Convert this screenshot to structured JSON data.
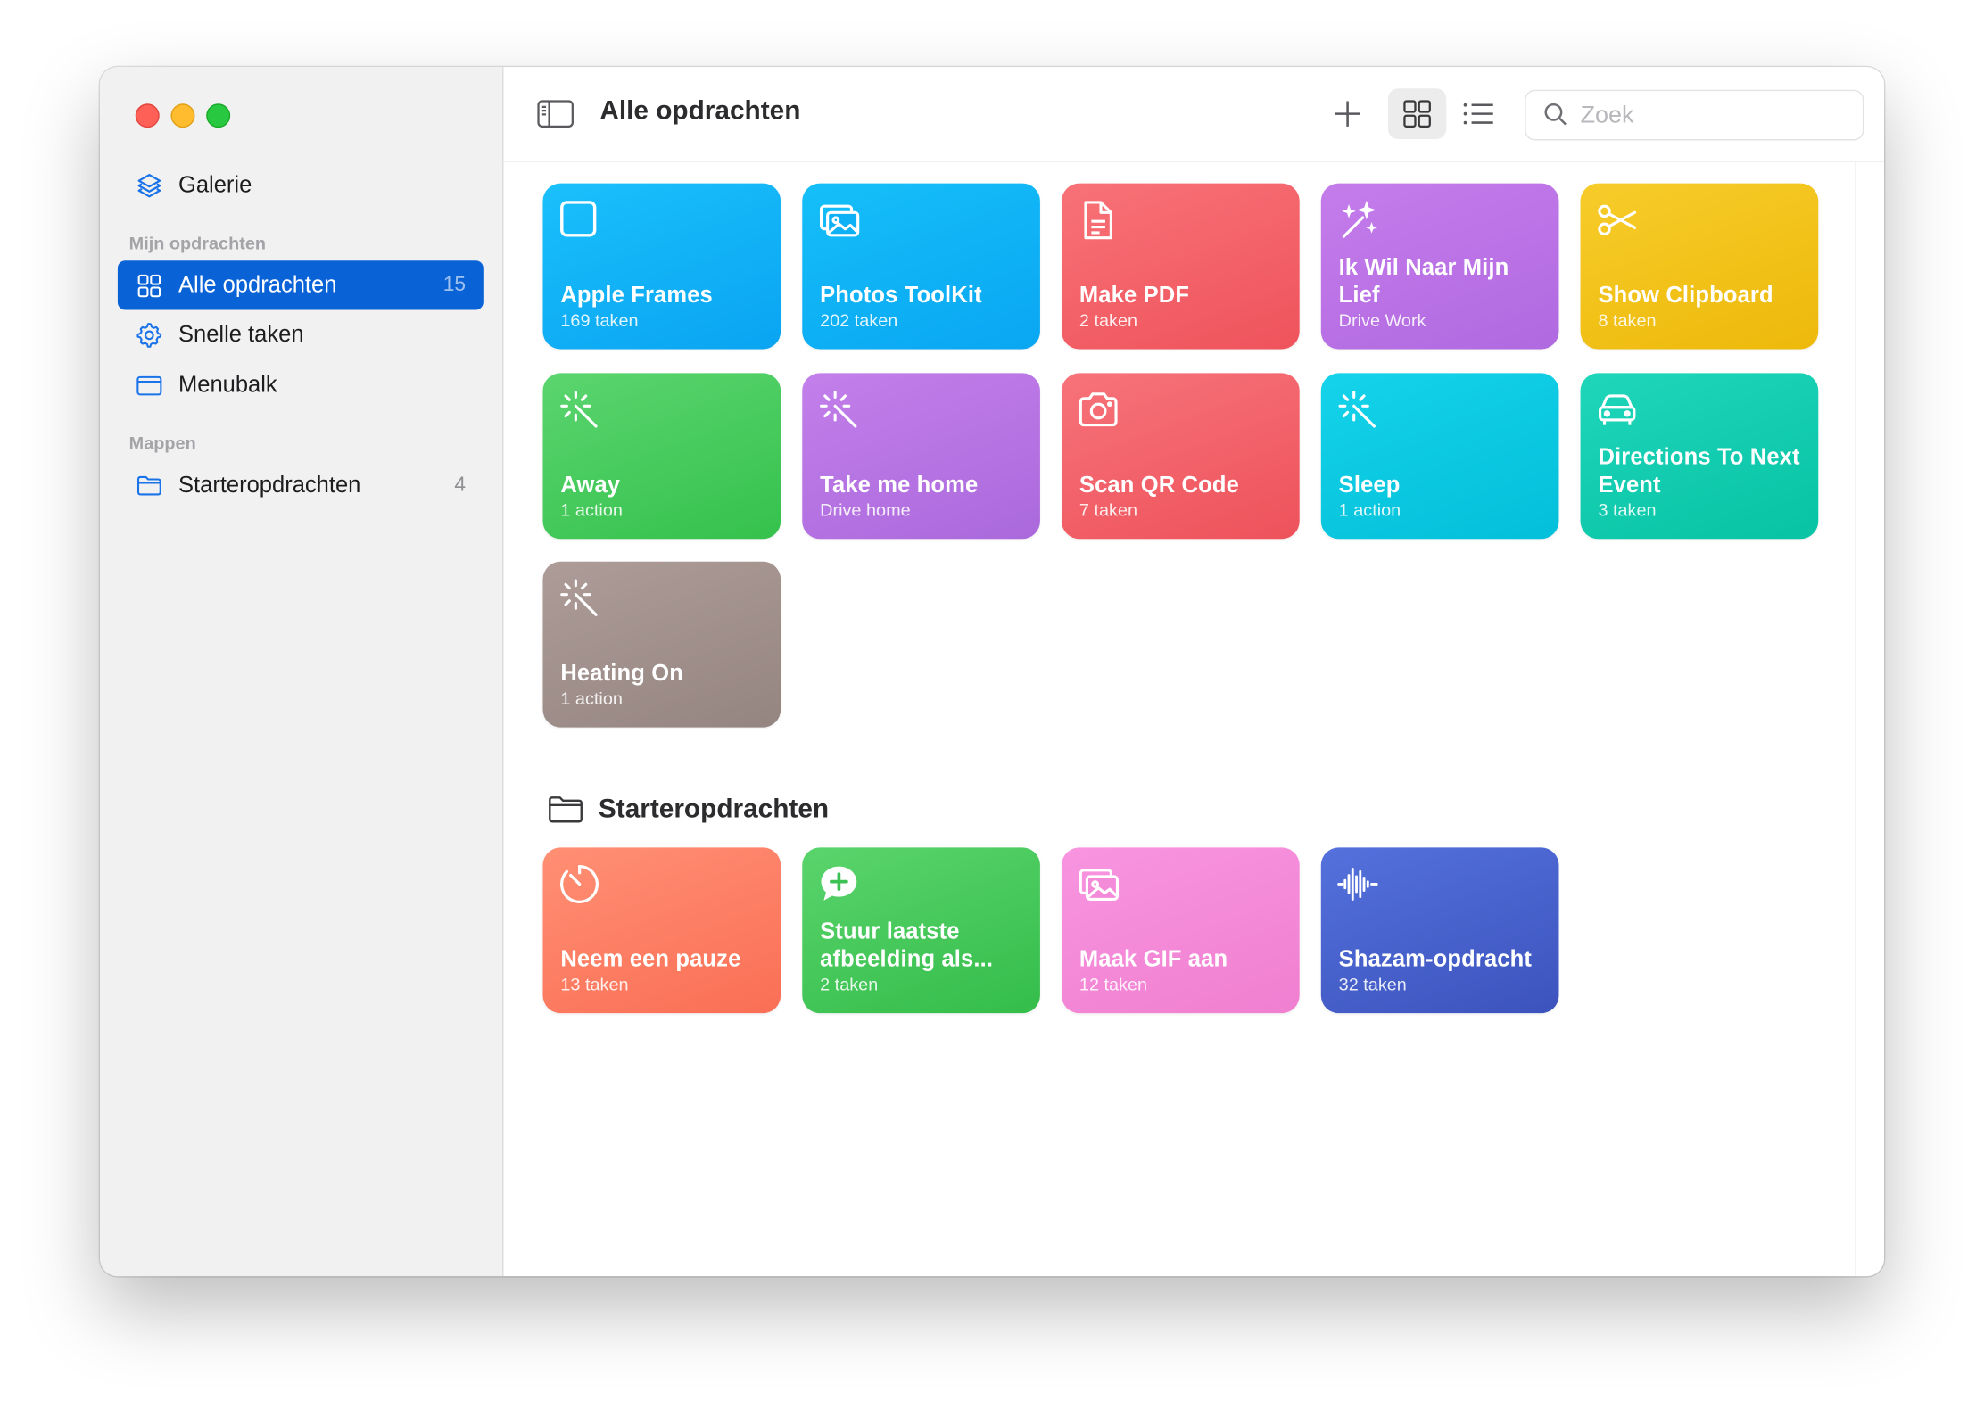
{
  "sidebar": {
    "gallery_label": "Galerie",
    "section_mine": "Mijn opdrachten",
    "items": [
      {
        "label": "Alle opdrachten",
        "count": "15"
      },
      {
        "label": "Snelle taken"
      },
      {
        "label": "Menubalk"
      }
    ],
    "section_folders": "Mappen",
    "folders": [
      {
        "label": "Starteropdrachten",
        "count": "4"
      }
    ]
  },
  "toolbar": {
    "title": "Alle opdrachten",
    "search_placeholder": "Zoek"
  },
  "shortcuts": [
    {
      "title": "Apple Frames",
      "subtitle": "169 taken",
      "icon": "square-icon",
      "color": "#0aa4f2"
    },
    {
      "title": "Photos ToolKit",
      "subtitle": "202 taken",
      "icon": "photos-icon",
      "color": "#0aa6f3"
    },
    {
      "title": "Make PDF",
      "subtitle": "2 taken",
      "icon": "document-icon",
      "color": "#ef535c"
    },
    {
      "title": "Ik Wil Naar Mijn Lief",
      "subtitle": "Drive Work",
      "icon": "sparkles-icon",
      "color": "#b069e0"
    },
    {
      "title": "Show Clipboard",
      "subtitle": "8 taken",
      "icon": "scissors-icon",
      "color": "#edb90b"
    },
    {
      "title": "Away",
      "subtitle": "1 action",
      "icon": "magic-wand-icon",
      "color": "#35c14c"
    },
    {
      "title": "Take me home",
      "subtitle": "Drive home",
      "icon": "magic-wand-icon",
      "color": "#aa69dc"
    },
    {
      "title": "Scan QR Code",
      "subtitle": "7 taken",
      "icon": "camera-icon",
      "color": "#ee525b"
    },
    {
      "title": "Sleep",
      "subtitle": "1 action",
      "icon": "magic-wand-icon",
      "color": "#04bfd9"
    },
    {
      "title": "Directions To Next Event",
      "subtitle": "3 taken",
      "icon": "car-icon",
      "color": "#08c3a4"
    },
    {
      "title": "Heating On",
      "subtitle": "1 action",
      "icon": "magic-wand-icon",
      "color": "#958581"
    }
  ],
  "folder_section": {
    "title": "Starteropdrachten",
    "shortcuts": [
      {
        "title": "Neem een pauze",
        "subtitle": "13 taken",
        "icon": "timer-icon",
        "color": "#fa6f55"
      },
      {
        "title": "Stuur laatste afbeelding als...",
        "subtitle": "2 taken",
        "icon": "message-plus-icon",
        "color": "#34bd4a"
      },
      {
        "title": "Maak GIF aan",
        "subtitle": "12 taken",
        "icon": "photos-icon",
        "color": "#f07fd0"
      },
      {
        "title": "Shazam-opdracht",
        "subtitle": "32 taken",
        "icon": "waveform-icon",
        "color": "#3c53bd"
      }
    ]
  }
}
